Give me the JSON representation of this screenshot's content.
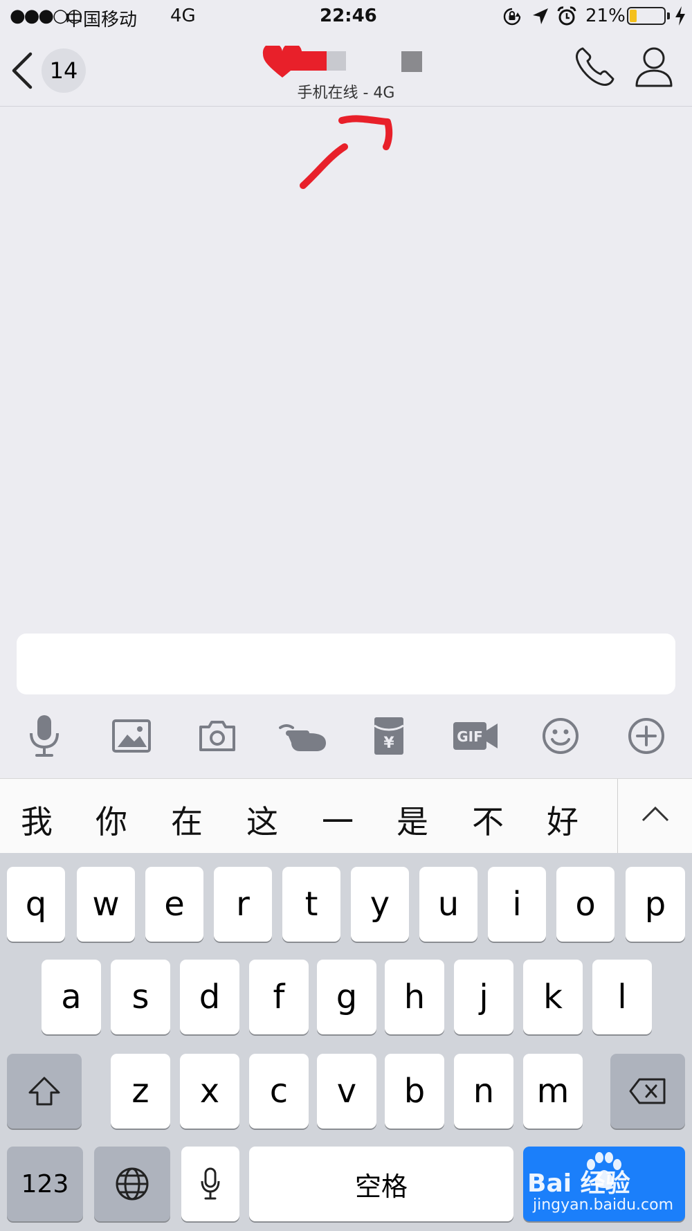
{
  "status_bar": {
    "signal": "●●●○○",
    "carrier": "中国移动",
    "network": "4G",
    "time": "22:46",
    "battery": "21%",
    "battery_level": 0.21
  },
  "nav": {
    "unread_count": "14",
    "subtitle": "手机在线 - 4G"
  },
  "input": {
    "placeholder": ""
  },
  "toolbar": {
    "items": [
      "mic-icon",
      "image-icon",
      "camera-icon",
      "poke-icon",
      "red-packet-icon",
      "gif-icon",
      "emoji-icon",
      "plus-icon"
    ]
  },
  "suggestions": [
    "我",
    "你",
    "在",
    "这",
    "一",
    "是",
    "不",
    "好"
  ],
  "keyboard": {
    "row1": [
      "q",
      "w",
      "e",
      "r",
      "t",
      "y",
      "u",
      "i",
      "o",
      "p"
    ],
    "row2": [
      "a",
      "s",
      "d",
      "f",
      "g",
      "h",
      "j",
      "k",
      "l"
    ],
    "row3": [
      "z",
      "x",
      "c",
      "v",
      "b",
      "n",
      "m"
    ],
    "numbers_key": "123",
    "space_key": "空格"
  },
  "watermark": {
    "brand": "Bai 经验",
    "url": "jingyan.baidu.com"
  },
  "colors": {
    "background": "#ececf1",
    "keyboard_bg": "#d1d4da",
    "return_key": "#1b7ffa",
    "annotation_red": "#e8202a",
    "battery_fill": "#f4c01e"
  }
}
